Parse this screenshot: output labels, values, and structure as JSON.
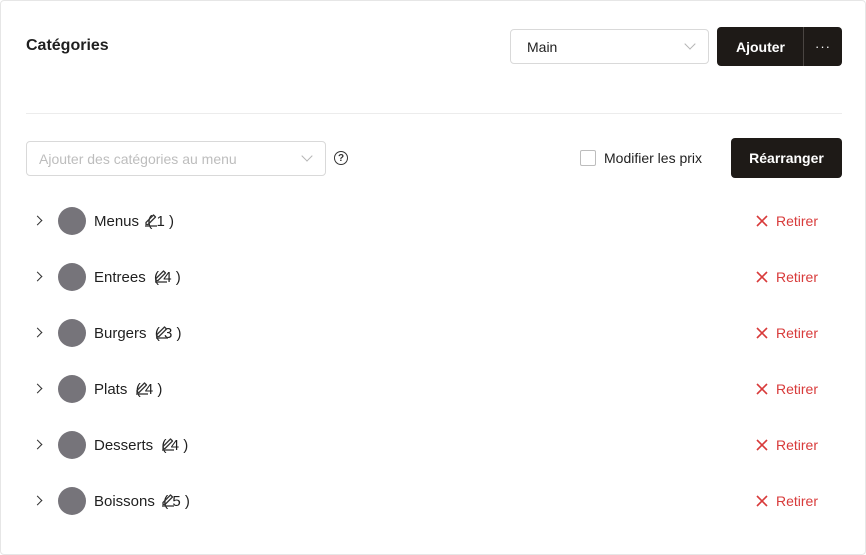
{
  "header": {
    "title": "Catégories",
    "menu_select_value": "Main",
    "add_label": "Ajouter",
    "more_label": "···"
  },
  "toolbar": {
    "category_select_placeholder": "Ajouter des catégories au menu",
    "help_glyph": "?",
    "edit_prices_label": "Modifier les prix",
    "edit_prices_checked": false,
    "rearrange_label": "Réarranger"
  },
  "categories": [
    {
      "name": "Menus",
      "count": "( 1 )"
    },
    {
      "name": "Entrees",
      "count": "( 4 )"
    },
    {
      "name": "Burgers",
      "count": "( 3 )"
    },
    {
      "name": "Plats",
      "count": "( 4 )"
    },
    {
      "name": "Desserts",
      "count": "( 4 )"
    },
    {
      "name": "Boissons",
      "count": "( 5 )"
    }
  ],
  "row_action_label": "Retirer",
  "colors": {
    "primary_button": "#1e1a17",
    "danger": "#d83a3a",
    "avatar": "#76747a"
  },
  "icons": {
    "expand": "chevron-right-icon",
    "edit": "pencil-icon",
    "remove": "close-icon",
    "help": "help-circle-icon",
    "dropdown": "chevron-down-icon"
  }
}
